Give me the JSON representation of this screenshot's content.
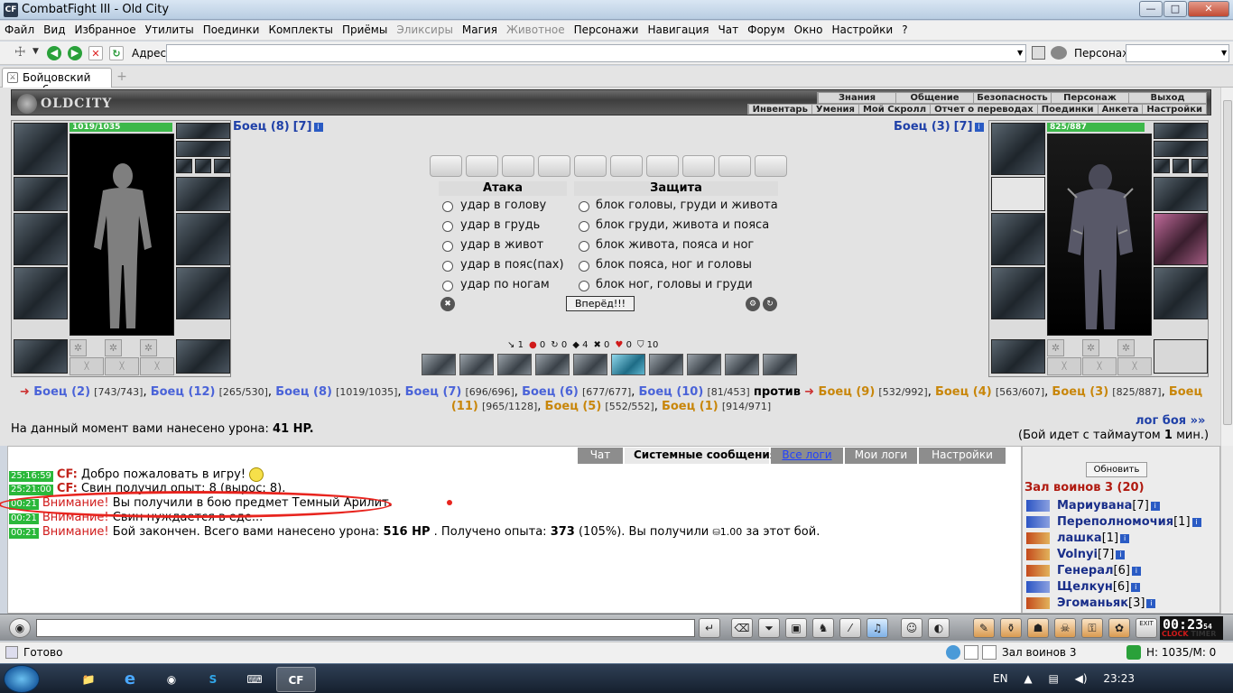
{
  "window": {
    "title": "CombatFight III - Old City",
    "app_icon": "CF"
  },
  "menu": [
    "Файл",
    "Вид",
    "Избранное",
    "Утилиты",
    "Поединки",
    "Комплекты",
    "Приёмы",
    "Эликсиры",
    "Магия",
    "Животное",
    "Персонажи",
    "Навигация",
    "Чат",
    "Форум",
    "Окно",
    "Настройки",
    "?"
  ],
  "menu_disabled": [
    "Эликсиры",
    "Животное"
  ],
  "addressbar": {
    "label": "Адрес:",
    "value": "",
    "persona_label": "Персонаж:",
    "persona_value": ""
  },
  "tab": {
    "title": "Бойцовский клуб"
  },
  "header": {
    "logo": "OLDCITY",
    "top_nav": [
      "Знания",
      "Общение",
      "Безопасность",
      "Персонаж",
      "Выход"
    ],
    "sub_nav": [
      "Инвентарь",
      "Умения",
      "Мой Скролл",
      "Отчет о переводах",
      "Поединки",
      "Анкета",
      "Настройки"
    ]
  },
  "left_fighter": {
    "name": "Боец (8)",
    "level": "[7]",
    "hp": "1019/1035",
    "hp_fraction": 0.984
  },
  "right_fighter": {
    "name": "Боец (3)",
    "level": "[7]",
    "hp": "825/887",
    "hp_fraction": 0.93
  },
  "combat": {
    "attack_title": "Атака",
    "defense_title": "Защита",
    "attacks": [
      "удар в голову",
      "удар в грудь",
      "удар в живот",
      "удар в пояс(пах)",
      "удар по ногам"
    ],
    "defenses": [
      "блок головы, груди и живота",
      "блок груди, живота и пояса",
      "блок живота, пояса и ног",
      "блок пояса, ног и головы",
      "блок ног, головы и груди"
    ],
    "forward_button": "Вперёд!!!",
    "stats": [
      {
        "icon": "strike-icon",
        "value": "1"
      },
      {
        "icon": "blood-icon",
        "value": "0"
      },
      {
        "icon": "counter-icon",
        "value": "0"
      },
      {
        "icon": "block-icon",
        "value": "4"
      },
      {
        "icon": "crit-icon",
        "value": "0"
      },
      {
        "icon": "heart-icon",
        "value": "0"
      },
      {
        "icon": "shield-icon",
        "value": "10"
      }
    ]
  },
  "teams": {
    "team1": [
      {
        "name": "Боец (2)",
        "hp": "[743/743]"
      },
      {
        "name": "Боец (12)",
        "hp": "[265/530]"
      },
      {
        "name": "Боец (8)",
        "hp": "[1019/1035]"
      },
      {
        "name": "Боец (7)",
        "hp": "[696/696]"
      },
      {
        "name": "Боец (6)",
        "hp": "[677/677]"
      },
      {
        "name": "Боец (10)",
        "hp": "[81/453]"
      }
    ],
    "versus": "против",
    "team2": [
      {
        "name": "Боец (9)",
        "hp": "[532/992]"
      },
      {
        "name": "Боец (4)",
        "hp": "[563/607]"
      },
      {
        "name": "Боец (3)",
        "hp": "[825/887]"
      },
      {
        "name": "Боец (11)",
        "hp": "[965/1128]"
      },
      {
        "name": "Боец (5)",
        "hp": "[552/552]"
      },
      {
        "name": "Боец (1)",
        "hp": "[914/971]"
      }
    ]
  },
  "damage": {
    "text": "На данный момент вами нанесено урона:",
    "value": "41 HP."
  },
  "battle_log": {
    "link": "лог боя »»",
    "timeout_pre": "(Бой идет с таймаутом",
    "timeout_val": "1",
    "timeout_post": "мин.)"
  },
  "chat": {
    "tabs": [
      "Чат",
      "Системные сообщения",
      "Все логи",
      "Мои логи",
      "Настройки"
    ],
    "messages": [
      {
        "time": "25:16:59",
        "who": "CF:",
        "text": "Добро пожаловать в игру!"
      },
      {
        "time": "25:21:00",
        "who": "CF:",
        "text": "Свин получил опыт: 8 (вырос: 8)."
      },
      {
        "time": "00:21",
        "who": "Внимание!",
        "text": "Вы получили в бою предмет Темный Арилит."
      },
      {
        "time": "00:21",
        "who": "Внимание!",
        "text": "Свин нуждается в еде..."
      },
      {
        "time": "00:21",
        "who": "Внимание!",
        "pre": "Бой закончен. Всего вами нанесено урона:",
        "b1": "516 HP",
        "mid": ". Получено опыта:",
        "b2": "373",
        "post": "(105%). Вы получили",
        "money": "1.00",
        "end": "за этот бой."
      }
    ]
  },
  "roster": {
    "refresh": "Обновить",
    "title": "Зал воинов 3 (20)",
    "players": [
      {
        "name": "Мариувана",
        "level": "[7]"
      },
      {
        "name": "Переполномочия",
        "level": "[1]"
      },
      {
        "name": "лашка",
        "level": "[1]"
      },
      {
        "name": "Volnyi",
        "level": "[7]"
      },
      {
        "name": "Генерал",
        "level": "[6]"
      },
      {
        "name": "Щелкун",
        "level": "[6]"
      },
      {
        "name": "Эгоманьяк",
        "level": "[3]"
      }
    ]
  },
  "clock": {
    "time": "00:23",
    "sec": "54",
    "labels": [
      "CLOCK",
      "TIMER"
    ]
  },
  "exit_label": "EXIT",
  "statusbar": {
    "text": "Готово",
    "location": "Зал воинов 3",
    "hp": "Н: 1035/М: 0"
  },
  "taskbar": {
    "lang": "EN",
    "time": "23:23",
    "app": "CF"
  }
}
